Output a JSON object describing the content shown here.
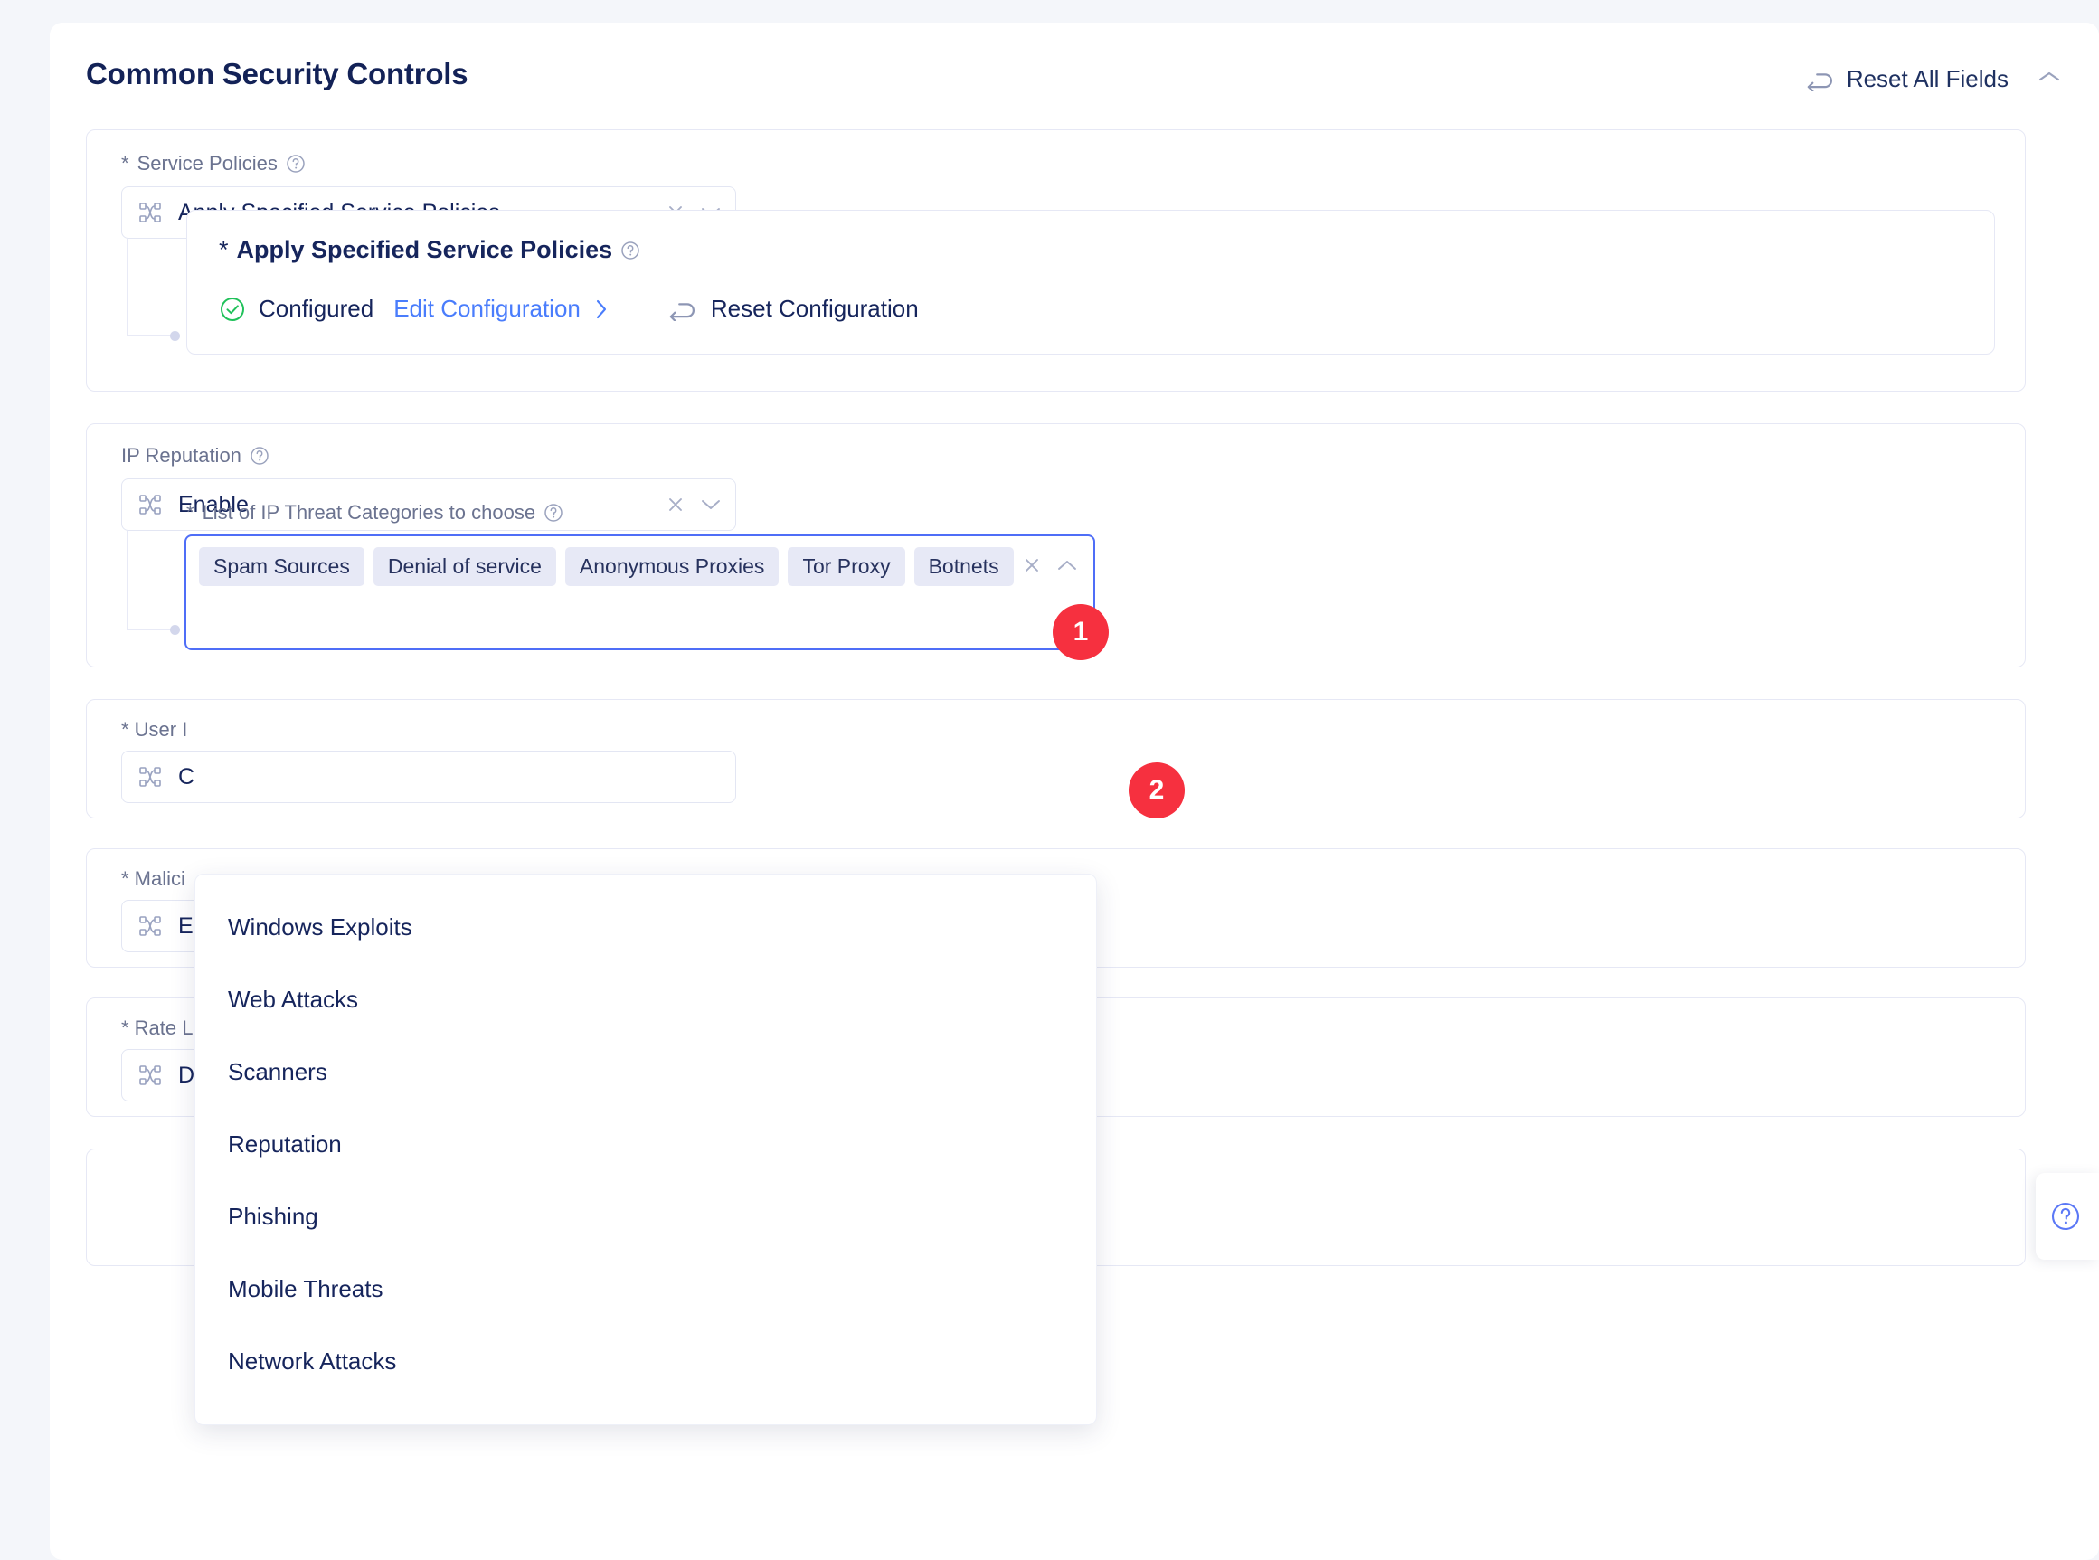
{
  "page": {
    "title": "Common Security Controls",
    "background_color": "#f4f6fa",
    "accent_color": "#4a7dfc",
    "badge_color": "#f6303f"
  },
  "header": {
    "reset_all_label": "Reset All Fields",
    "reset_icon": "reset-arrow-icon",
    "collapse_icon": "chevron-up-icon"
  },
  "service_policies": {
    "label": "Service Policies",
    "required_mark": "*",
    "help_icon": "help-circle-icon",
    "select": {
      "value": "Apply Specified Service Policies",
      "leading_icon": "shuffle-icon",
      "clear_icon": "clear-x-icon",
      "caret_icon": "chevron-down-icon"
    },
    "subcard": {
      "required_mark": "*",
      "title": "Apply Specified Service Policies",
      "help_icon": "help-circle-icon",
      "status_icon": "check-circle-icon",
      "status_text": "Configured",
      "edit_link": "Edit Configuration",
      "edit_chevron_icon": "chevron-right-icon",
      "reset_icon": "reset-arrow-icon",
      "reset_label": "Reset Configuration"
    }
  },
  "ip_reputation": {
    "label": "IP Reputation",
    "help_icon": "help-circle-icon",
    "select": {
      "value": "Enable",
      "leading_icon": "shuffle-icon",
      "clear_icon": "clear-x-icon",
      "caret_icon": "chevron-down-icon"
    },
    "badge": "1",
    "categories": {
      "required_mark": "*",
      "label": "List of IP Threat Categories to choose",
      "help_icon": "help-circle-icon",
      "selected": [
        "Spam Sources",
        "Denial of service",
        "Anonymous Proxies",
        "Tor Proxy",
        "Botnets"
      ],
      "clear_icon": "clear-x-icon",
      "caret_icon": "chevron-up-icon",
      "badge": "2",
      "options": [
        "Windows Exploits",
        "Web Attacks",
        "Scanners",
        "Reputation",
        "Phishing",
        "Mobile Threats",
        "Network Attacks"
      ]
    }
  },
  "hidden_fields": [
    {
      "label_visible": "* User I",
      "value_visible": "C",
      "leading_icon": "shuffle-icon"
    },
    {
      "label_visible": "* Malici",
      "value_visible": "E",
      "leading_icon": "shuffle-icon"
    },
    {
      "label_visible": "* Rate L",
      "value_visible": "D",
      "leading_icon": "shuffle-icon"
    }
  ],
  "help_widget": {
    "icon": "help-circle-icon"
  }
}
